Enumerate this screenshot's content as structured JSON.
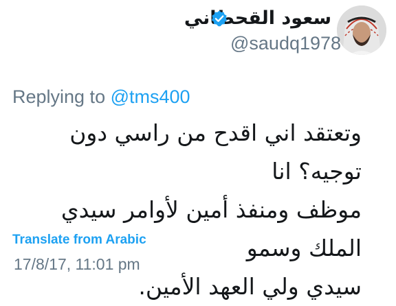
{
  "tweet": {
    "display_name": "سعود القحطاني",
    "handle": "@saudq1978",
    "replying_prefix": "Replying to ",
    "replying_to": "@tms400",
    "text_lines": [
      "وتعتقد اني اقدح من راسي دون توجيه؟ انا",
      "موظف ومنفذ أمين لأوامر سيدي الملك وسمو",
      "سيدي ولي العهد الأمين."
    ],
    "translate_label": "Translate from Arabic",
    "timestamp": "17/8/17, 11:01 pm"
  },
  "icons": {
    "verified": "verified-badge-icon",
    "menu": "chevron-down-icon",
    "avatar": "profile-photo"
  },
  "colors": {
    "accent": "#1da1f2",
    "secondary_text": "#657786",
    "primary_text": "#14171a"
  }
}
